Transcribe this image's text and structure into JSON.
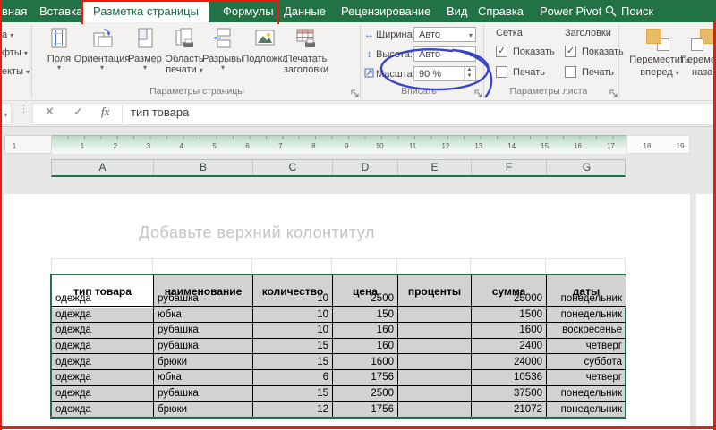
{
  "colors": {
    "excel_green": "#217346",
    "annotation_red": "#ea1c0d",
    "annotation_blue": "#2936c6",
    "table_fill_grey": "#d2d2d2"
  },
  "tabs": {
    "items": [
      "вная",
      "Вставка",
      "Разметка страницы",
      "Формулы",
      "Данные",
      "Рецензирование",
      "Вид",
      "Справка",
      "Power Pivot",
      "Поиск"
    ],
    "active": "Разметка страницы"
  },
  "ribbon": {
    "themes_cut": [
      "а",
      "фты",
      "екты"
    ],
    "page_setup": {
      "group_label": "Параметры страницы",
      "margins": "Поля",
      "orientation": "Ориентация",
      "size": "Размер",
      "print_area_l1": "Область",
      "print_area_l2": "печати",
      "breaks": "Разрывы",
      "watermark": "Подложка",
      "print_titles_l1": "Печатать",
      "print_titles_l2": "заголовки"
    },
    "fit": {
      "group_label": "Вписать",
      "width_label": "Ширина:",
      "width_value": "Авто",
      "height_label": "Высота:",
      "height_value": "Авто",
      "scale_label": "Масштаб:",
      "scale_value": "90 %"
    },
    "sheet_options": {
      "group_label": "Параметры листа",
      "gridlines_title": "Сетка",
      "headings_title": "Заголовки",
      "show_label": "Показать",
      "print_label": "Печать",
      "gridlines_show_checked": true,
      "gridlines_print_checked": false,
      "headings_show_checked": true,
      "headings_print_checked": false
    },
    "arrange": {
      "bring_forward_l1": "Переместить",
      "bring_forward_l2": "вперед",
      "send_backward_l1": "Переме",
      "send_backward_l2": "наза"
    }
  },
  "formula_bar": {
    "fx_label": "fx",
    "value": "тип товара"
  },
  "ruler": {
    "outside_left": "1",
    "numbers": [
      "1",
      "2",
      "3",
      "4",
      "5",
      "6",
      "7",
      "8",
      "9",
      "10",
      "11",
      "12",
      "13",
      "14",
      "15",
      "16",
      "17"
    ],
    "outside_right": [
      "18",
      "19"
    ]
  },
  "sheet": {
    "columns": [
      "A",
      "B",
      "C",
      "D",
      "E",
      "F",
      "G"
    ],
    "header_placeholder": "Добавьте верхний колонтитул"
  },
  "table": {
    "headers": [
      "тип товара",
      "наименование",
      "количество",
      "цена",
      "проценты",
      "сумма",
      "даты"
    ],
    "rows": [
      [
        "одежда",
        "рубашка",
        "10",
        "2500",
        "",
        "25000",
        "понедельник"
      ],
      [
        "одежда",
        "юбка",
        "10",
        "150",
        "",
        "1500",
        "понедельник"
      ],
      [
        "одежда",
        "рубашка",
        "10",
        "160",
        "",
        "1600",
        "воскресенье"
      ],
      [
        "одежда",
        "рубашка",
        "15",
        "160",
        "",
        "2400",
        "четверг"
      ],
      [
        "одежда",
        "брюки",
        "15",
        "1600",
        "",
        "24000",
        "суббота"
      ],
      [
        "одежда",
        "юбка",
        "6",
        "1756",
        "",
        "10536",
        "четверг"
      ],
      [
        "одежда",
        "рубашка",
        "15",
        "2500",
        "",
        "37500",
        "понедельник"
      ],
      [
        "одежда",
        "брюки",
        "12",
        "1756",
        "",
        "21072",
        "понедельник"
      ]
    ]
  }
}
